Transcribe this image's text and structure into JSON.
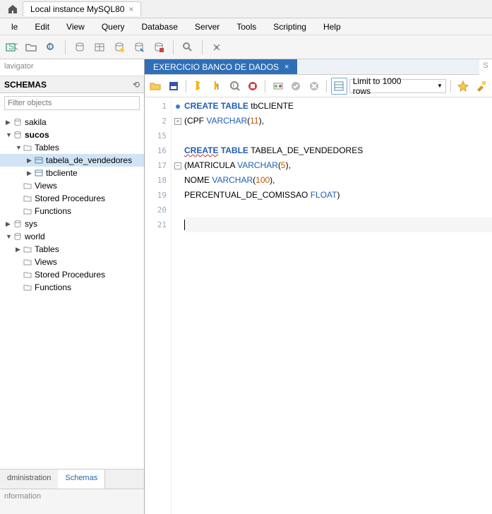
{
  "connection_tab": "Local instance MySQL80",
  "menu": [
    "le",
    "Edit",
    "View",
    "Query",
    "Database",
    "Server",
    "Tools",
    "Scripting",
    "Help"
  ],
  "navigator": {
    "title": "lavigator",
    "section": "SCHEMAS",
    "filter_placeholder": "Filter objects",
    "tabs": {
      "admin": "dministration",
      "schemas": "Schemas"
    },
    "info": "nformation"
  },
  "tree": {
    "db_sakila": "sakila",
    "db_sucos": "sucos",
    "folder_tables": "Tables",
    "tbl_vendedores": "tabela_de_vendedores",
    "tbl_tbcliente": "tbcliente",
    "folder_views": "Views",
    "folder_sp": "Stored Procedures",
    "folder_fn": "Functions",
    "db_sys": "sys",
    "db_world": "world"
  },
  "editor_tab": "EXERCICIO BANCO DE DADOS",
  "limit_label": "Limit to 1000 rows",
  "code": {
    "l1_a": "CREATE",
    "l1_b": "TABLE",
    "l1_c": "tbCLIENTE",
    "l2_a": "(CPF ",
    "l2_b": "VARCHAR",
    "l2_c": "(",
    "l2_d": "11",
    "l2_e": "),",
    "l16_a": "CREATE",
    "l16_b": "TABLE",
    "l16_c": "TABELA_DE_VENDEDORES",
    "l17_a": "(MATRICULA ",
    "l17_b": "VARCHAR",
    "l17_c": "(",
    "l17_d": "5",
    "l17_e": "),",
    "l18_a": "NOME ",
    "l18_b": "VARCHAR",
    "l18_c": "(",
    "l18_d": "100",
    "l18_e": "),",
    "l19_a": "PERCENTUAL_DE_COMISSAO ",
    "l19_b": "FLOAT",
    "l19_c": ")"
  },
  "line_numbers": [
    "1",
    "2",
    "15",
    "16",
    "17",
    "18",
    "19",
    "20",
    "21"
  ]
}
